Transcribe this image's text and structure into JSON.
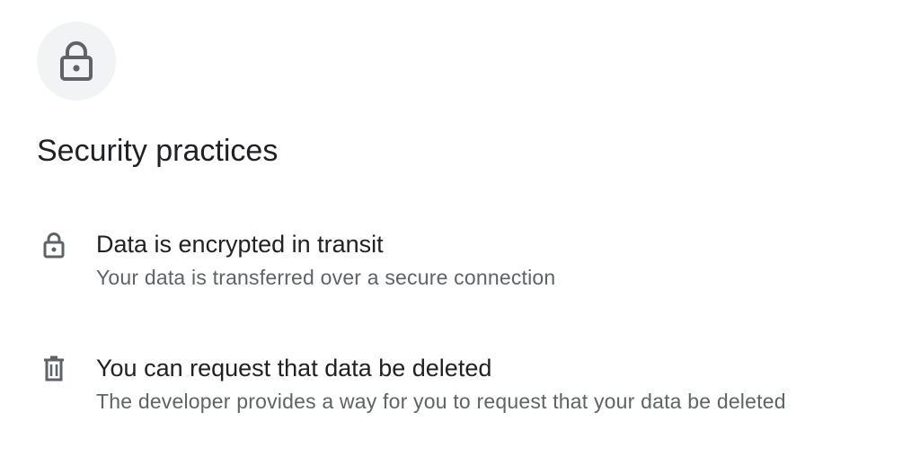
{
  "section": {
    "title": "Security practices",
    "header_icon": "lock-icon"
  },
  "items": [
    {
      "icon": "lock-icon",
      "title": "Data is encrypted in transit",
      "description": "Your data is transferred over a secure connection"
    },
    {
      "icon": "trash-icon",
      "title": "You can request that data be deleted",
      "description": "The developer provides a way for you to request that your data be deleted"
    }
  ],
  "colors": {
    "icon": "#5f6368",
    "title": "#202124",
    "description": "#5f6368",
    "icon_circle": "#f1f3f4"
  }
}
